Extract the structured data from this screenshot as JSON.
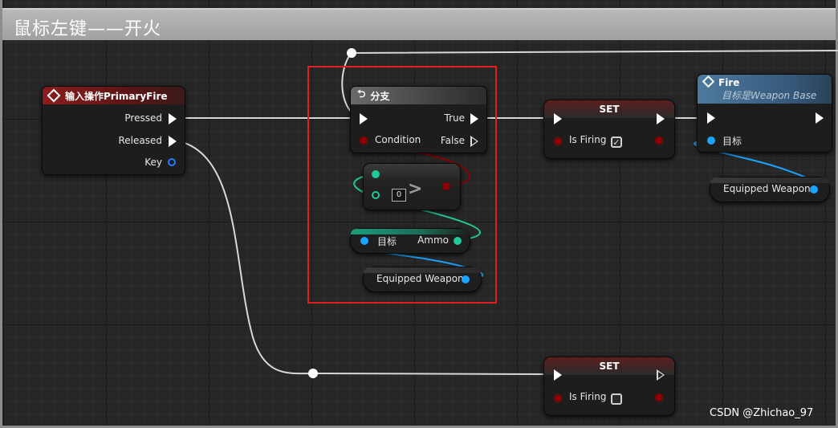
{
  "comment": {
    "title": "鼠标左键——开火"
  },
  "nodes": {
    "input_action": {
      "title": "输入操作PrimaryFire",
      "pins": {
        "pressed": "Pressed",
        "released": "Released",
        "key": "Key"
      }
    },
    "branch": {
      "title": "分支",
      "pins": {
        "true": "True",
        "false": "False",
        "condition": "Condition"
      }
    },
    "greater": {
      "symbol": ">",
      "value": "0"
    },
    "get_ammo": {
      "target": "目标",
      "output": "Ammo"
    },
    "equipped_weapon_1": {
      "label": "Equipped Weapon"
    },
    "equipped_weapon_2": {
      "label": "Equipped Weapon"
    },
    "set_top": {
      "title": "SET",
      "var": "Is Firing",
      "checked": "✓"
    },
    "set_bottom": {
      "title": "SET",
      "var": "Is Firing",
      "checked": ""
    },
    "fire": {
      "title": "Fire",
      "subtitle": "目标是Weapon Base",
      "target": "目标"
    }
  },
  "colors": {
    "exec": "#ffffff",
    "bool_pin": "#8b0000",
    "int_pin": "#1fc99a",
    "object_pin": "#1aa3ff",
    "highlight": "#e02020"
  },
  "watermark": "CSDN @Zhichao_97"
}
